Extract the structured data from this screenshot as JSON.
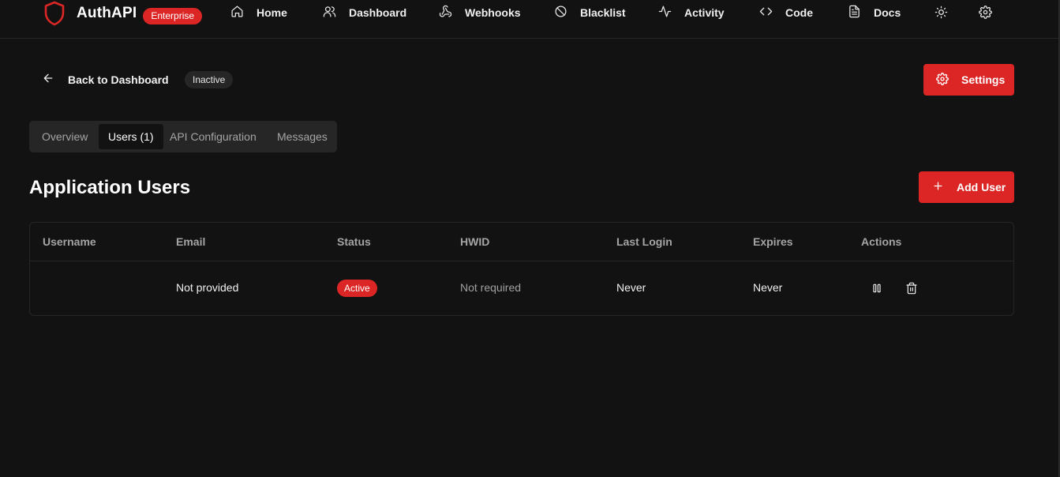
{
  "brand": {
    "name": "AuthAPI",
    "plan_badge": "Enterprise",
    "accent": "#dc2626"
  },
  "nav": {
    "items": [
      {
        "label": "Home",
        "icon": "home-icon"
      },
      {
        "label": "Dashboard",
        "icon": "users-icon"
      },
      {
        "label": "Webhooks",
        "icon": "webhook-icon"
      },
      {
        "label": "Blacklist",
        "icon": "ban-icon"
      },
      {
        "label": "Activity",
        "icon": "activity-icon"
      },
      {
        "label": "Code",
        "icon": "code-icon"
      },
      {
        "label": "Docs",
        "icon": "file-icon"
      }
    ],
    "theme_icon": "sun-icon",
    "settings_icon": "gear-icon"
  },
  "header": {
    "back_label": "Back to Dashboard",
    "status": "Inactive",
    "settings_label": "Settings"
  },
  "tabs": [
    {
      "label": "Overview",
      "active": false
    },
    {
      "label": "Users (1)",
      "active": true
    },
    {
      "label": "API Configuration",
      "active": false
    },
    {
      "label": "Messages",
      "active": false
    }
  ],
  "section": {
    "title": "Application Users",
    "add_label": "Add User"
  },
  "table": {
    "columns": [
      "Username",
      "Email",
      "Status",
      "HWID",
      "Last Login",
      "Expires",
      "Actions"
    ],
    "rows": [
      {
        "username": "",
        "email": "Not provided",
        "status": "Active",
        "hwid": "Not required",
        "last_login": "Never",
        "expires": "Never",
        "actions": [
          "pause-icon",
          "trash-icon"
        ]
      }
    ]
  }
}
